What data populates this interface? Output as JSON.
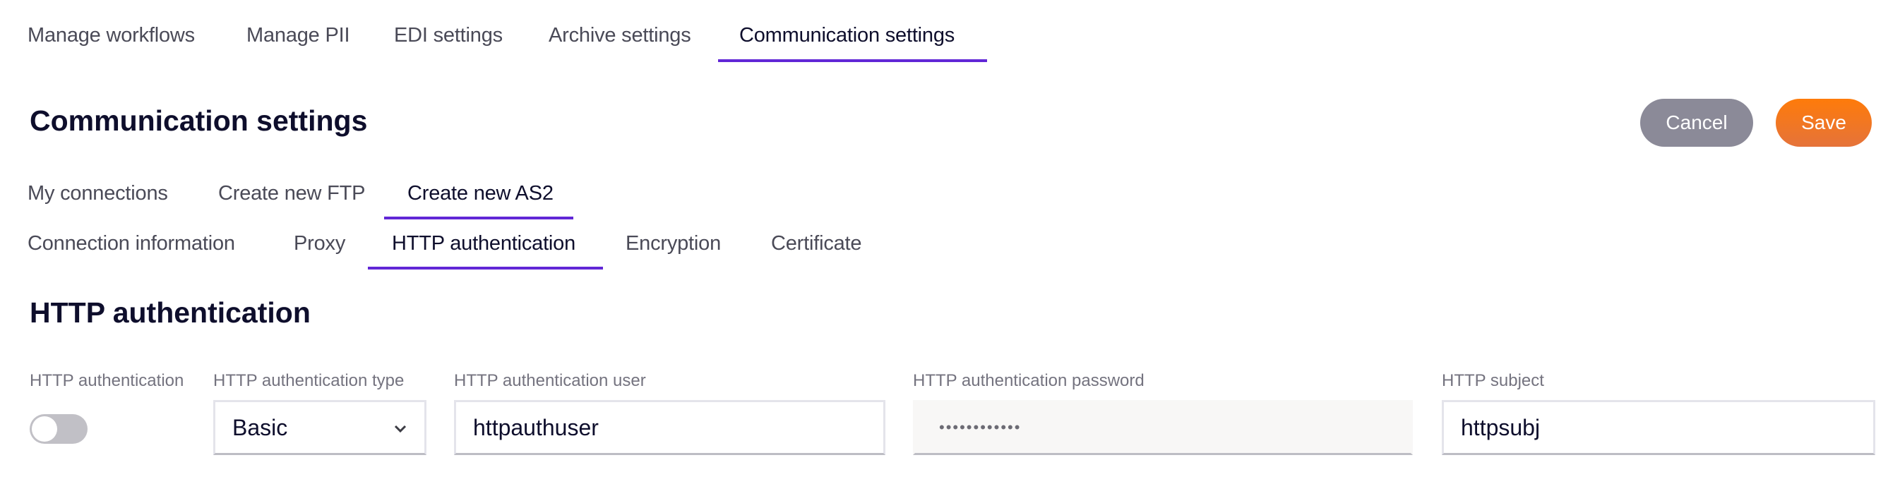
{
  "top_tabs": [
    {
      "label": "Manage workflows",
      "active": false
    },
    {
      "label": "Manage PII",
      "active": false
    },
    {
      "label": "EDI settings",
      "active": false
    },
    {
      "label": "Archive settings",
      "active": false
    },
    {
      "label": "Communication settings",
      "active": true
    }
  ],
  "page": {
    "title": "Communication settings",
    "cancel_label": "Cancel",
    "save_label": "Save"
  },
  "connection_tabs": [
    {
      "label": "My connections",
      "active": false
    },
    {
      "label": "Create new FTP",
      "active": false
    },
    {
      "label": "Create new AS2",
      "active": true
    }
  ],
  "as2_tabs": [
    {
      "label": "Connection information",
      "active": false
    },
    {
      "label": "Proxy",
      "active": false
    },
    {
      "label": "HTTP authentication",
      "active": true
    },
    {
      "label": "Encryption",
      "active": false
    },
    {
      "label": "Certificate",
      "active": false
    }
  ],
  "section": {
    "title": "HTTP authentication",
    "fields": {
      "auth_toggle": {
        "label": "HTTP authentication",
        "enabled": false
      },
      "auth_type": {
        "label": "HTTP authentication type",
        "value": "Basic",
        "icon": "chevron-down-icon"
      },
      "auth_user": {
        "label": "HTTP authentication user",
        "value": "httpauthuser"
      },
      "auth_password": {
        "label": "HTTP authentication password",
        "value": "••••••••••••",
        "disabled": true
      },
      "subject": {
        "label": "HTTP subject",
        "value": "httpsubj"
      }
    }
  },
  "colors": {
    "accent": "#6127d6",
    "save": "#fe7b0a",
    "cancel": "#8b8a98",
    "text_dark": "#0e0e2c",
    "label": "#74737f"
  }
}
